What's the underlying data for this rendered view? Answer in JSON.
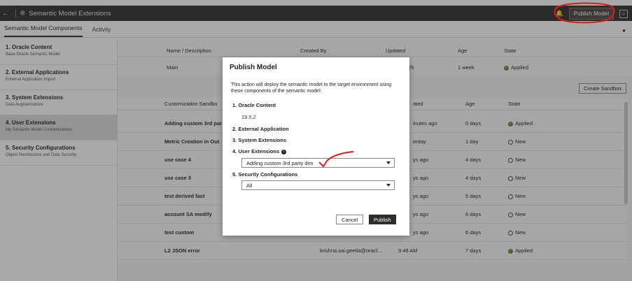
{
  "header": {
    "title": "Semantic Model Extensions",
    "publish_label": "Publish Model"
  },
  "tabs": [
    {
      "label": "Semantic Model Components"
    },
    {
      "label": "Activity"
    }
  ],
  "sidebar": {
    "items": [
      {
        "title": "1. Oracle Content",
        "subtitle": "Base Oracle Semantic Model"
      },
      {
        "title": "2. External Applications",
        "subtitle": "External Application Import"
      },
      {
        "title": "3. System Extensions",
        "subtitle": "Data Augmentations"
      },
      {
        "title": "4. User Extensions",
        "subtitle": "My Semantic Model Customizations"
      },
      {
        "title": "5. Security Configurations",
        "subtitle": "Object Permissions and Data Security"
      }
    ]
  },
  "main_table": {
    "headers": [
      "Name / Description",
      "Created By",
      "Updated",
      "Age",
      "State"
    ],
    "row": {
      "name": "Main",
      "updated": "25",
      "age": "1 week",
      "state": "Applied"
    }
  },
  "create_sandbox_label": "Create Sandbox",
  "sandbox_table": {
    "headers": [
      "Customization Sandbo",
      "ated",
      "Age",
      "State"
    ],
    "rows": [
      {
        "name": "Adding custom 3rd par",
        "created_by": "",
        "updated": "inutes ago",
        "age": "0 days",
        "state": "Applied"
      },
      {
        "name": "Metric Creation in Out",
        "created_by": "",
        "updated": "erday",
        "age": "1 day",
        "state": "New"
      },
      {
        "name": "use case 4",
        "created_by": "",
        "updated": "ys ago",
        "age": "4 days",
        "state": "New"
      },
      {
        "name": "use case 3",
        "created_by": "",
        "updated": "ys ago",
        "age": "4 days",
        "state": "New"
      },
      {
        "name": "test derived fact",
        "created_by": "",
        "updated": "ys ago",
        "age": "5 days",
        "state": "New"
      },
      {
        "name": "account SA modify",
        "created_by": "",
        "updated": "ys ago",
        "age": "6 days",
        "state": "New"
      },
      {
        "name": "test custom",
        "created_by": "",
        "updated": "ys ago",
        "age": "6 days",
        "state": "New"
      },
      {
        "name": "L2 JSON error",
        "created_by": "krishna.sai.geetla@oracl...",
        "updated": "9:48 AM",
        "age": "7 days",
        "state": "Applied"
      }
    ]
  },
  "modal": {
    "title": "Publish Model",
    "description": "This action will deploy the semantic model to the target environment using these components of the semantic model:",
    "s1": "1. Oracle Content",
    "s1_version": "19.5.2",
    "s2": "2. External Application",
    "s3": "3. System Extensions",
    "s4": "4. User Extensions",
    "s4_value": "Adding custom 3rd party dim",
    "s5": "5. Security Configurations",
    "s5_value": "All",
    "cancel": "Cancel",
    "publish": "Publish"
  },
  "colors": {
    "topbar": "#312d2a",
    "applied": "#4f8a3d",
    "annotation": "#e0191b"
  }
}
